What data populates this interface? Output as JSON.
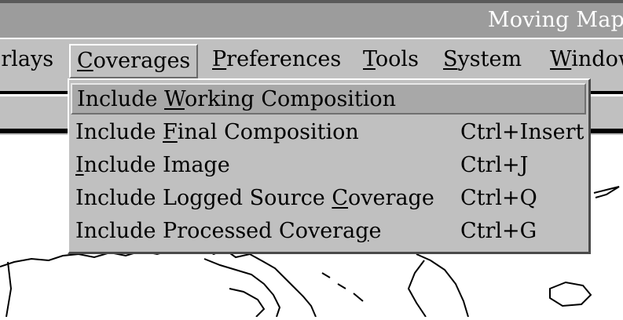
{
  "window": {
    "title": "Moving Map"
  },
  "menubar": {
    "items": [
      {
        "label": "Overlays"
      },
      {
        "pre": "",
        "key": "C",
        "post": "overages"
      },
      {
        "pre": "",
        "key": "P",
        "post": "references"
      },
      {
        "pre": "",
        "key": "T",
        "post": "ools"
      },
      {
        "pre": "",
        "key": "S",
        "post": "ystem"
      },
      {
        "pre": "",
        "key": "W",
        "post": "indow"
      }
    ]
  },
  "dropdown": {
    "items": [
      {
        "pre": "Include ",
        "key": "W",
        "post": "orking Composition",
        "shortcut": ""
      },
      {
        "pre": "Include ",
        "key": "F",
        "post": "inal Composition",
        "shortcut": "Ctrl+Insert"
      },
      {
        "pre": "",
        "key": "I",
        "post": "nclude Image",
        "shortcut": "Ctrl+J"
      },
      {
        "pre": "Include Logged Source ",
        "key": "C",
        "post": "overage",
        "shortcut": "Ctrl+Q"
      },
      {
        "pre": "Include Processed Covera",
        "key": "g",
        "post": "e",
        "shortcut": "Ctrl+G"
      }
    ]
  }
}
